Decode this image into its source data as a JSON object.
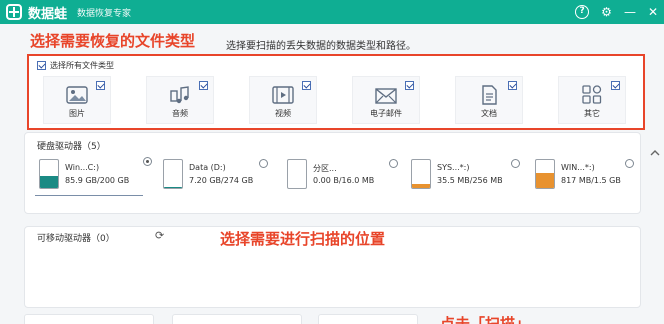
{
  "titlebar": {
    "app_name": "数据蛙",
    "subtitle": "数据恢复专家",
    "help": "?",
    "settings": "⚙",
    "minimize": "—",
    "close": "✕"
  },
  "annotations": {
    "select_type": "选择需要恢复的文件类型",
    "select_hint": "选择要扫描的丢失数据的数据类型和路径。",
    "select_location": "选择需要进行扫描的位置",
    "click_scan": "点击「扫描」"
  },
  "file_types": {
    "select_all_label": "选择所有文件类型",
    "items": [
      {
        "label": "图片",
        "icon": "image-icon",
        "checked": true
      },
      {
        "label": "音频",
        "icon": "music-icon",
        "checked": true
      },
      {
        "label": "视频",
        "icon": "video-icon",
        "checked": true
      },
      {
        "label": "电子邮件",
        "icon": "email-icon",
        "checked": true
      },
      {
        "label": "文档",
        "icon": "document-icon",
        "checked": true
      },
      {
        "label": "其它",
        "icon": "other-icon",
        "checked": true
      }
    ]
  },
  "hard_drives": {
    "title": "硬盘驱动器（5）",
    "drives": [
      {
        "name": "Win...C:)",
        "size": "85.9 GB/200 GB",
        "fill": 0.43,
        "color": "#1a8a84",
        "selected": true
      },
      {
        "name": "Data (D:)",
        "size": "7.20 GB/274 GB",
        "fill": 0.03,
        "color": "#1a8a84",
        "selected": false
      },
      {
        "name": "分区...",
        "size": "0.00  B/16.0 MB",
        "fill": 0.0,
        "color": "#e8922f",
        "selected": false
      },
      {
        "name": "SYS...*:)",
        "size": "35.5 MB/256 MB",
        "fill": 0.14,
        "color": "#e8922f",
        "selected": false
      },
      {
        "name": "WIN...*:)",
        "size": "817 MB/1.5 GB",
        "fill": 0.53,
        "color": "#e8922f",
        "selected": false
      }
    ]
  },
  "removable": {
    "title": "可移动驱动器（0）",
    "refresh_icon": "refresh-icon"
  }
}
